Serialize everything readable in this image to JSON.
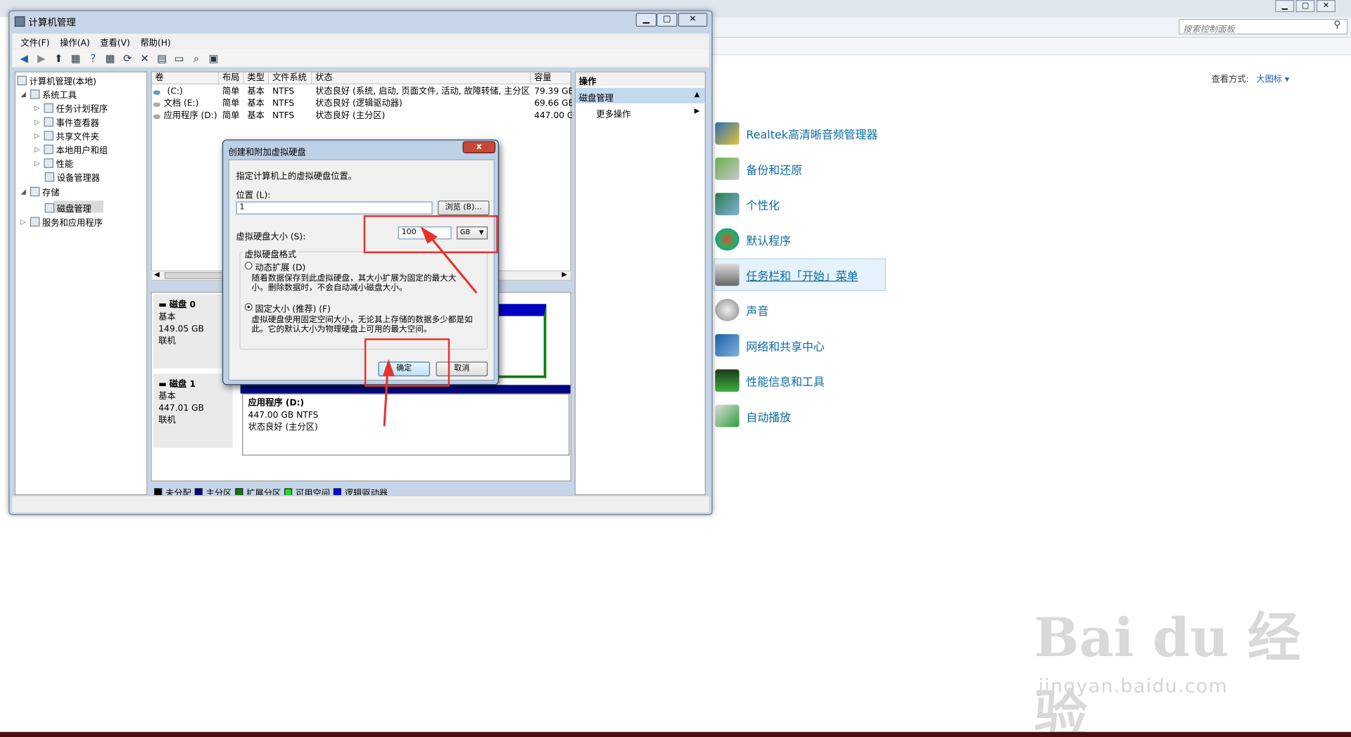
{
  "window": {
    "title": "计算机管理",
    "min": "▁",
    "max": "▢",
    "close": "✕"
  },
  "menu": [
    "文件(F)",
    "操作(A)",
    "查看(V)",
    "帮助(H)"
  ],
  "tree": {
    "root": "计算机管理(本地)",
    "system_tools": "系统工具",
    "task_scheduler": "任务计划程序",
    "event_viewer": "事件查看器",
    "shared_folders": "共享文件夹",
    "local_users": "本地用户和组",
    "performance": "性能",
    "device_manager": "设备管理器",
    "storage": "存储",
    "disk_management": "磁盘管理",
    "services": "服务和应用程序"
  },
  "volumes": {
    "headers": [
      "卷",
      "布局",
      "类型",
      "文件系统",
      "状态",
      "容量"
    ],
    "rows": [
      {
        "vol": "(C:)",
        "layout": "简单",
        "type": "基本",
        "fs": "NTFS",
        "status": "状态良好 (系统, 启动, 页面文件, 活动, 故障转储, 主分区)",
        "cap": "79.39 GE"
      },
      {
        "vol": "文档 (E:)",
        "layout": "简单",
        "type": "基本",
        "fs": "NTFS",
        "status": "状态良好 (逻辑驱动器)",
        "cap": "69.66 GE"
      },
      {
        "vol": "应用程序 (D:)",
        "layout": "简单",
        "type": "基本",
        "fs": "NTFS",
        "status": "状态良好 (主分区)",
        "cap": "447.00 G"
      }
    ]
  },
  "disks": {
    "disk0": {
      "name": "磁盘 0",
      "type": "基本",
      "size": "149.05 GB",
      "state": "联机"
    },
    "disk1": {
      "name": "磁盘 1",
      "type": "基本",
      "size": "447.01 GB",
      "state": "联机",
      "part_name": "应用程序  (D:)",
      "part_size": "447.00 GB NTFS",
      "part_status": "状态良好 (主分区)"
    }
  },
  "legend": [
    "未分配",
    "主分区",
    "扩展分区",
    "可用空间",
    "逻辑驱动器"
  ],
  "legend_colors": [
    "#000000",
    "#000080",
    "#0a7e0a",
    "#22dd22",
    "#0000ff"
  ],
  "actions": {
    "header": "操作",
    "selected": "磁盘管理",
    "more": "更多操作",
    "collapse_arrow": "▲",
    "more_arrow": "▶"
  },
  "dialog": {
    "title": "创建和附加虚拟硬盘",
    "close": "x",
    "intro": "指定计算机上的虚拟硬盘位置。",
    "location_label": "位置 (L):",
    "location_value": "1",
    "browse": "浏览 (B)...",
    "size_label": "虚拟硬盘大小 (S):",
    "size_value": "100",
    "unit": "GB",
    "format_label": "虚拟硬盘格式",
    "dynamic_label": "动态扩展 (D)",
    "dynamic_desc1": "随着数据保存到此虚拟硬盘，其大小扩展为固定的最大大",
    "dynamic_desc2": "小。删除数据时，不会自动减小磁盘大小。",
    "fixed_label": "固定大小 (推荐) (F)",
    "fixed_desc1": "虚拟硬盘使用固定空间大小，无论其上存储的数据多少都是如",
    "fixed_desc2": "此。它的默认大小为物理硬盘上可用的最大空间。",
    "ok": "确定",
    "cancel": "取消"
  },
  "control_panel": {
    "search_placeholder": "搜索控制面板",
    "view_label": "查看方式:",
    "view_value": "大图标 ▾",
    "items": [
      "Realtek高清晰音频管理器",
      "备份和还原",
      "个性化",
      "默认程序",
      "任务栏和「开始」菜单",
      "声音",
      "网络和共享中心",
      "性能信息和工具",
      "自动播放"
    ]
  },
  "watermark": {
    "main": "Bai du 经验",
    "sub": "jingyan.baidu.com"
  }
}
